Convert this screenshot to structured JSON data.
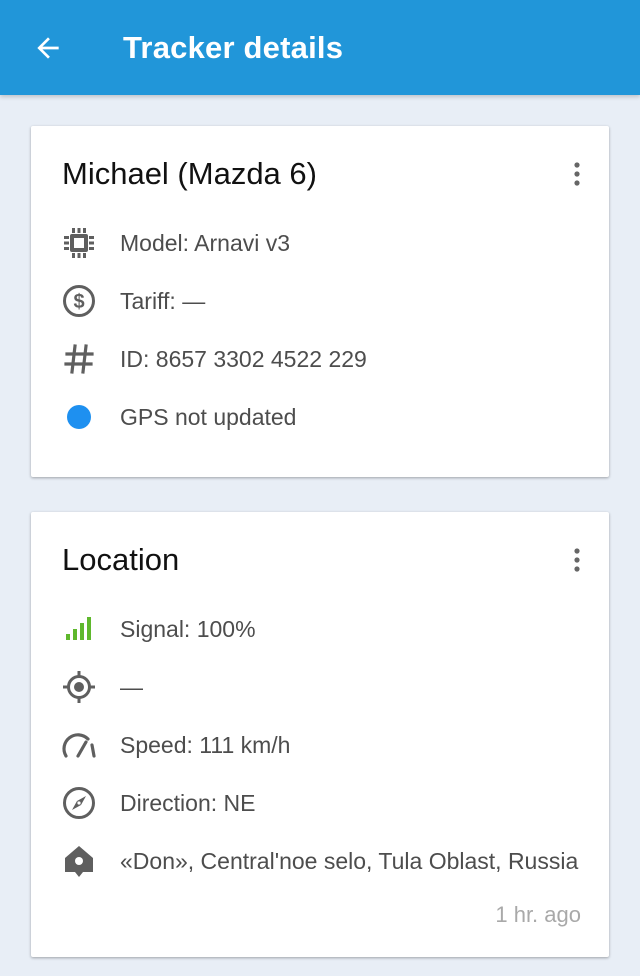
{
  "appbar": {
    "back_icon": "arrow-back-icon",
    "title": "Tracker details",
    "background": "#2196d9"
  },
  "tracker_card": {
    "title": "Michael (Mazda 6)",
    "menu_icon": "more-vert-icon",
    "rows": [
      {
        "icon": "chip-icon",
        "text": "Model: Arnavi v3"
      },
      {
        "icon": "dollar-circle-icon",
        "text": "Tariff:  —"
      },
      {
        "icon": "hash-icon",
        "text": "ID: 8657 3302 4522 229"
      },
      {
        "icon": "gps-status-dot-icon",
        "text": "GPS not updated",
        "color": "#1e90f0"
      }
    ]
  },
  "location_card": {
    "title": "Location",
    "menu_icon": "more-vert-icon",
    "rows": [
      {
        "icon": "signal-bars-icon",
        "text": "Signal: 100%",
        "color": "#5fb82d"
      },
      {
        "icon": "gps-fixed-icon",
        "text": " —"
      },
      {
        "icon": "speedometer-icon",
        "text": "Speed: 111 km/h"
      },
      {
        "icon": "compass-icon",
        "text": "Direction: NE"
      },
      {
        "icon": "home-pin-icon",
        "text": "«Don», Central'noe selo, Tula Oblast, Russia"
      }
    ],
    "timestamp": "1 hr. ago"
  }
}
